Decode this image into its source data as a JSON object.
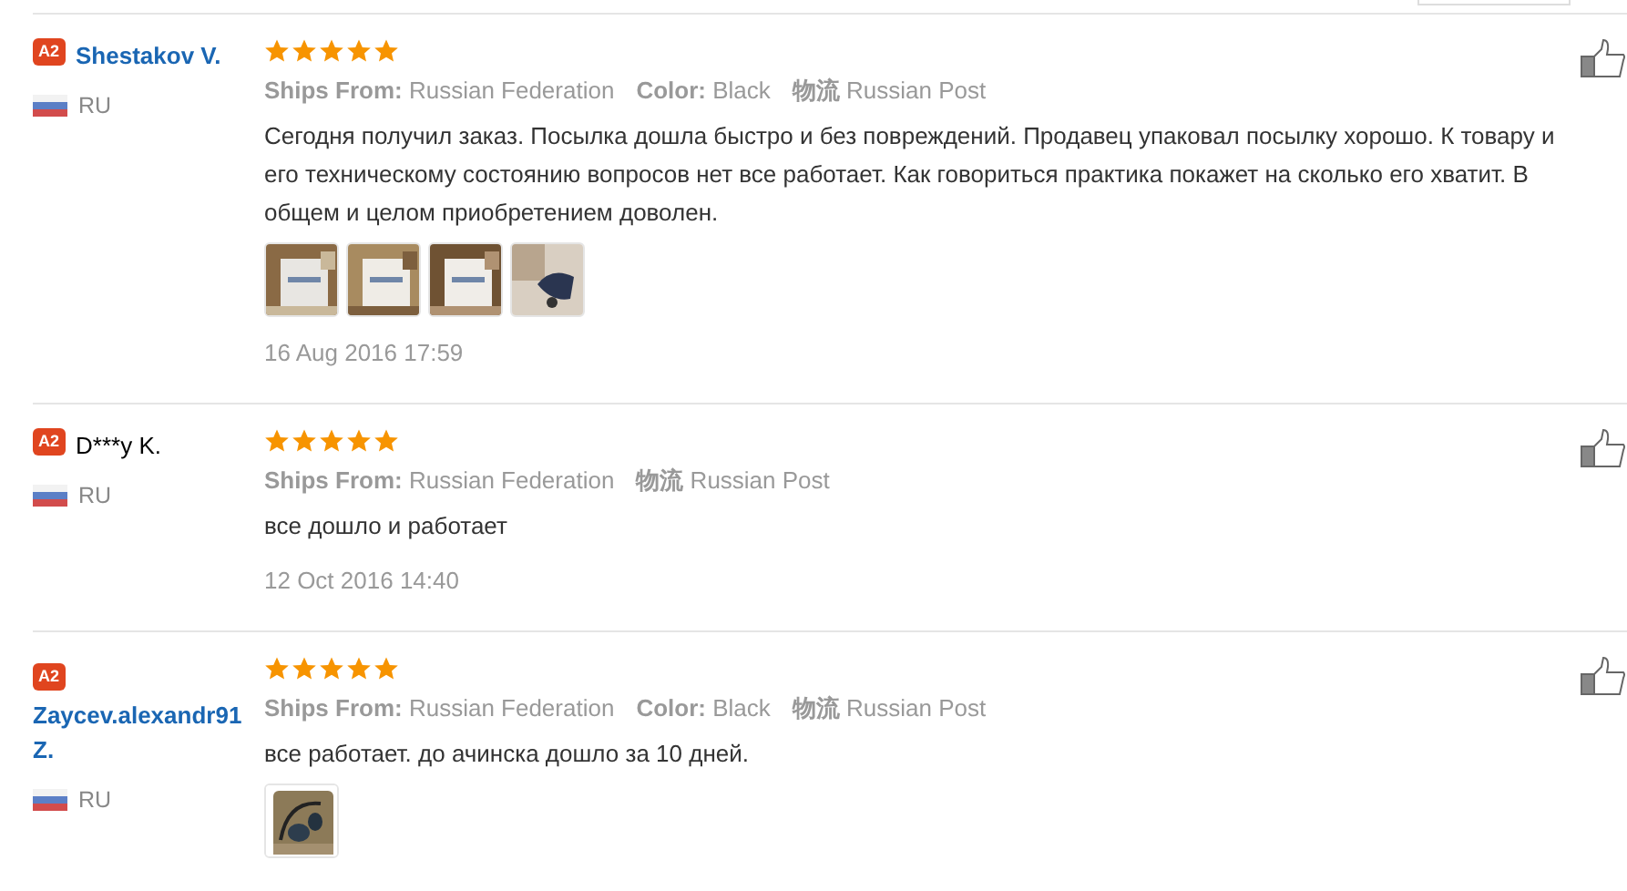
{
  "reviews": [
    {
      "badge": "A2",
      "name": "Shestakov V.",
      "linked": true,
      "country": "RU",
      "stars": 5,
      "attributes": [
        {
          "label": "Ships From:",
          "value": "Russian Federation"
        },
        {
          "label": "Color:",
          "value": "Black"
        },
        {
          "label": "物流",
          "value": "Russian Post"
        }
      ],
      "text": "Сегодня получил заказ. Посылка дошла быстро и без повреждений. Продавец упаковал посылку хорошо. К товару и его техническому состоянию вопросов нет все работает. Как говориться практика покажет на сколько его хватит. В общем и целом приобретением доволен.",
      "photos": [
        {
          "kind": "picture"
        },
        {
          "kind": "picture"
        },
        {
          "kind": "picture"
        },
        {
          "kind": "picture"
        }
      ],
      "date": "16 Aug 2016 17:59"
    },
    {
      "badge": "A2",
      "name": "D***y K.",
      "linked": false,
      "country": "RU",
      "stars": 5,
      "attributes": [
        {
          "label": "Ships From:",
          "value": "Russian Federation"
        },
        {
          "label": "物流",
          "value": "Russian Post"
        }
      ],
      "text": "все дошло и работает",
      "date": "12 Oct 2016 14:40"
    },
    {
      "badge": "A2",
      "name": "Zaycev.alexandr91 Z.",
      "linked": true,
      "country": "RU",
      "stars": 5,
      "attributes": [
        {
          "label": "Ships From:",
          "value": "Russian Federation"
        },
        {
          "label": "Color:",
          "value": "Black"
        },
        {
          "label": "物流",
          "value": "Russian Post"
        }
      ],
      "text": "все работает. до ачинска дошло за 10 дней.",
      "photos": [
        {
          "kind": "picture"
        }
      ]
    }
  ]
}
